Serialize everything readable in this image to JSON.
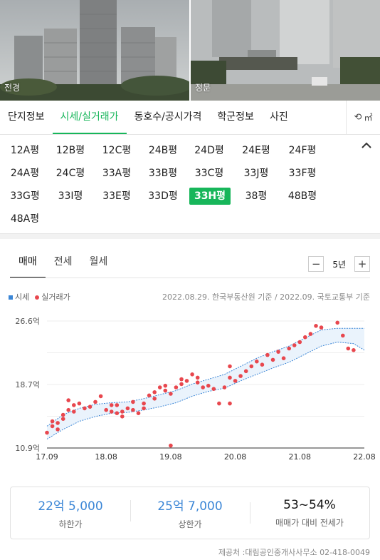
{
  "photos": [
    {
      "caption": "전경"
    },
    {
      "caption": "정문"
    }
  ],
  "tabs": [
    "단지정보",
    "시세/실거래가",
    "동호수/공시가격",
    "학군정보",
    "사진"
  ],
  "tab_tool": "㎡",
  "sizes": [
    "12A평",
    "12B평",
    "12C평",
    "24B평",
    "24D평",
    "24E평",
    "24F평",
    "24A평",
    "24C평",
    "33A평",
    "33B평",
    "33C평",
    "33J평",
    "33F평",
    "33G평",
    "33I평",
    "33E평",
    "33D평",
    "33H평",
    "38평",
    "48B평",
    "48A평"
  ],
  "active_size": "33H평",
  "subtabs": [
    "매매",
    "전세",
    "월세"
  ],
  "period": {
    "minus": "−",
    "label": "5년",
    "plus": "+"
  },
  "legend": {
    "market": "시세",
    "deal": "실거래가"
  },
  "source": "2022.08.29. 한국부동산원 기준 / 2022.09. 국토교통부 기준",
  "colors": {
    "accent": "#17b65a",
    "market": "#3b86d6",
    "deal": "#e8474e"
  },
  "chart_data": {
    "type": "scatter",
    "x_ticks": [
      "17.09",
      "18.08",
      "19.08",
      "20.08",
      "21.08",
      "22.08"
    ],
    "y_ticks": [
      "26.6억",
      "18.7억",
      "10.9억"
    ],
    "ylim": [
      10.9,
      26.6
    ],
    "series": [
      {
        "name": "시세",
        "type": "area",
        "x": [
          "17.09",
          "17.12",
          "18.03",
          "18.06",
          "18.09",
          "18.12",
          "19.03",
          "19.06",
          "19.09",
          "19.12",
          "20.03",
          "20.06",
          "20.09",
          "20.12",
          "21.03",
          "21.06",
          "21.09",
          "21.12",
          "22.03",
          "22.06",
          "22.08"
        ],
        "upper": [
          13.6,
          15.0,
          15.8,
          16.3,
          16.5,
          16.6,
          17.0,
          17.5,
          18.0,
          18.8,
          19.4,
          20.0,
          21.0,
          22.0,
          22.8,
          23.5,
          24.5,
          25.5,
          25.7,
          25.7,
          25.7
        ],
        "lower": [
          12.0,
          13.2,
          14.2,
          14.8,
          15.2,
          15.3,
          15.6,
          16.0,
          16.5,
          17.3,
          17.9,
          18.3,
          19.2,
          20.0,
          20.8,
          21.5,
          22.5,
          23.5,
          24.0,
          23.8,
          23.0
        ]
      },
      {
        "name": "실거래가",
        "type": "scatter",
        "points": [
          [
            "17.09",
            12.8
          ],
          [
            "17.10",
            13.6
          ],
          [
            "17.10",
            14.2
          ],
          [
            "17.11",
            14.0
          ],
          [
            "17.11",
            13.2
          ],
          [
            "17.12",
            14.5
          ],
          [
            "17.12",
            15.0
          ],
          [
            "18.01",
            15.6
          ],
          [
            "18.01",
            16.8
          ],
          [
            "18.02",
            16.2
          ],
          [
            "18.02",
            15.4
          ],
          [
            "18.03",
            16.4
          ],
          [
            "18.04",
            15.8
          ],
          [
            "18.05",
            16.0
          ],
          [
            "18.06",
            16.6
          ],
          [
            "18.07",
            17.3
          ],
          [
            "18.08",
            15.6
          ],
          [
            "18.09",
            15.4
          ],
          [
            "18.09",
            16.2
          ],
          [
            "18.10",
            15.2
          ],
          [
            "18.10",
            16.2
          ],
          [
            "18.11",
            14.8
          ],
          [
            "18.11",
            15.4
          ],
          [
            "18.12",
            15.8
          ],
          [
            "19.01",
            16.6
          ],
          [
            "19.01",
            15.6
          ],
          [
            "19.02",
            15.2
          ],
          [
            "19.03",
            15.8
          ],
          [
            "19.03",
            16.4
          ],
          [
            "19.04",
            17.4
          ],
          [
            "19.05",
            17.0
          ],
          [
            "19.05",
            17.8
          ],
          [
            "19.06",
            18.4
          ],
          [
            "19.07",
            18.0
          ],
          [
            "19.07",
            18.6
          ],
          [
            "19.08",
            17.6
          ],
          [
            "19.08",
            11.2
          ],
          [
            "19.09",
            18.4
          ],
          [
            "19.10",
            19.4
          ],
          [
            "19.10",
            18.8
          ],
          [
            "19.11",
            19.2
          ],
          [
            "19.12",
            20.0
          ],
          [
            "20.01",
            19.6
          ],
          [
            "20.01",
            19.0
          ],
          [
            "20.02",
            18.4
          ],
          [
            "20.03",
            18.6
          ],
          [
            "20.04",
            18.2
          ],
          [
            "20.05",
            16.4
          ],
          [
            "20.06",
            18.4
          ],
          [
            "20.07",
            21.0
          ],
          [
            "20.07",
            19.6
          ],
          [
            "20.07",
            16.4
          ],
          [
            "20.08",
            19.2
          ],
          [
            "20.09",
            19.8
          ],
          [
            "20.10",
            20.4
          ],
          [
            "20.11",
            21.0
          ],
          [
            "20.12",
            21.6
          ],
          [
            "21.01",
            21.2
          ],
          [
            "21.02",
            22.4
          ],
          [
            "21.03",
            21.8
          ],
          [
            "21.04",
            22.8
          ],
          [
            "21.05",
            22.0
          ],
          [
            "21.06",
            23.2
          ],
          [
            "21.07",
            23.6
          ],
          [
            "21.08",
            24.0
          ],
          [
            "21.09",
            24.6
          ],
          [
            "21.10",
            25.0
          ],
          [
            "21.11",
            26.0
          ],
          [
            "21.12",
            25.8
          ],
          [
            "22.03",
            26.4
          ],
          [
            "22.04",
            24.8
          ],
          [
            "22.05",
            23.2
          ],
          [
            "22.06",
            23.0
          ]
        ]
      }
    ]
  },
  "summary": [
    {
      "value": "22억 5,000",
      "label": "하한가"
    },
    {
      "value": "25억 7,000",
      "label": "상한가"
    },
    {
      "value": "53~54%",
      "label": "매매가 대비 전세가"
    }
  ],
  "footer": "제공처 :대림공인중개사사무소 02-418-0049"
}
